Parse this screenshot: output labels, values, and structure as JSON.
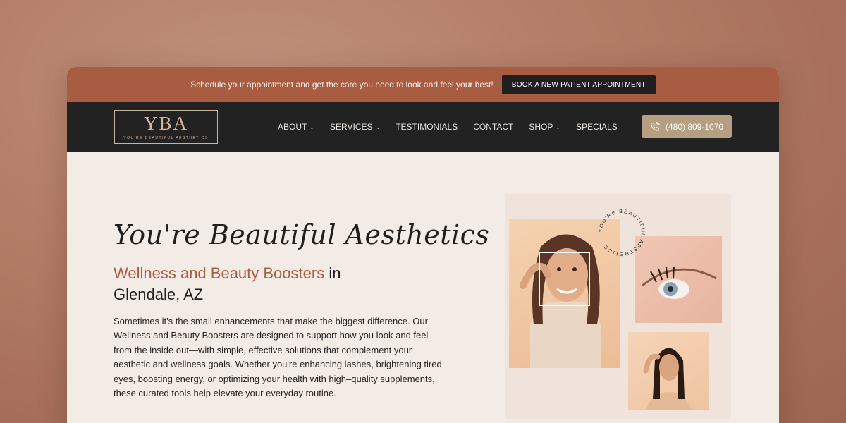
{
  "topbar": {
    "message": "Schedule your appointment and get the care you need to look and feel your best!",
    "cta_label": "BOOK A NEW PATIENT APPOINTMENT"
  },
  "logo": {
    "mark": "YBA",
    "subtitle": "YOU'RE BEAUTIFUL AESTHETICS"
  },
  "nav": {
    "items": [
      {
        "label": "ABOUT",
        "has_dropdown": true
      },
      {
        "label": "SERVICES",
        "has_dropdown": true
      },
      {
        "label": "TESTIMONIALS",
        "has_dropdown": false
      },
      {
        "label": "CONTACT",
        "has_dropdown": false
      },
      {
        "label": "SHOP",
        "has_dropdown": true
      },
      {
        "label": "SPECIALS",
        "has_dropdown": false
      }
    ],
    "phone": "(480) 809-1070"
  },
  "hero": {
    "script_title": "You're Beautiful Aesthetics",
    "subhead_accent": "Wellness and Beauty Boosters",
    "subhead_rest": " in",
    "subhead_line2": "Glendale, AZ",
    "body": "Sometimes it's the small enhancements that make the biggest difference. Our Wellness and Beauty Boosters are designed to support how you look and feel from the inside out—with simple, effective solutions that complement your aesthetic and wellness goals. Whether you're enhancing lashes, brightening tired eyes, boosting energy, or optimizing your health with high–quality supplements, these curated tools help elevate your everyday routine.",
    "badge_text": "YOU'RE BEAUTIFUL AESTHETICS"
  },
  "colors": {
    "accent": "#a85d42",
    "nav_bg": "#222222",
    "phone_btn": "#b59e82",
    "page_bg": "#f3ebe6"
  }
}
